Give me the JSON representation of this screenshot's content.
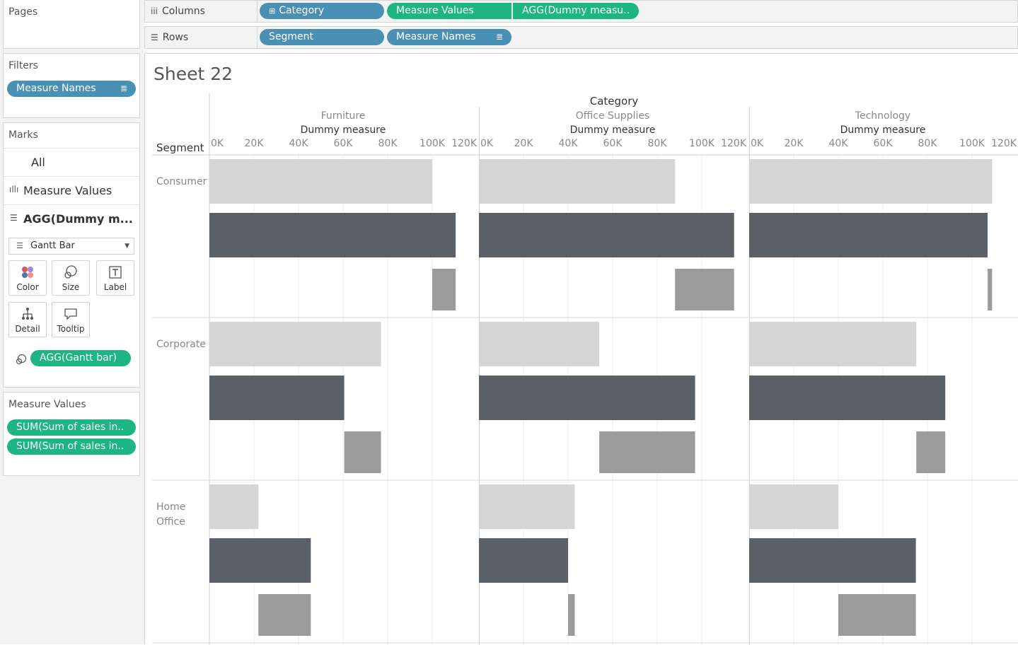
{
  "pages": {
    "title": "Pages"
  },
  "filters": {
    "title": "Filters",
    "pills": [
      {
        "label": "Measure Names"
      }
    ]
  },
  "marks": {
    "title": "Marks",
    "layers": [
      {
        "label": "All"
      },
      {
        "label": "Measure Values"
      },
      {
        "label": "AGG(Dummy m..."
      }
    ],
    "mark_type": "Gantt Bar",
    "buttons": [
      {
        "label": "Color"
      },
      {
        "label": "Size"
      },
      {
        "label": "Label"
      },
      {
        "label": "Detail"
      },
      {
        "label": "Tooltip"
      }
    ],
    "size_pill": "AGG(Gantt bar)"
  },
  "measure_values_card": {
    "title": "Measure Values",
    "pills": [
      {
        "label": "SUM(Sum of sales in.."
      },
      {
        "label": "SUM(Sum of sales in.."
      }
    ]
  },
  "columns_shelf": {
    "label": "Columns",
    "pills": [
      {
        "label": "Category",
        "prefix": "⊞"
      },
      {
        "label": "Measure Values"
      },
      {
        "label": "AGG(Dummy measu.."
      }
    ]
  },
  "rows_shelf": {
    "label": "Rows",
    "pills": [
      {
        "label": "Segment"
      },
      {
        "label": "Measure Names"
      }
    ]
  },
  "sheet": {
    "title": "Sheet 22"
  },
  "chart_data": {
    "type": "gantt",
    "header_title": "Category",
    "row_field": "Segment",
    "axis_title": "Dummy measure",
    "xlim": [
      0,
      120000
    ],
    "ticks": [
      "0K",
      "20K",
      "40K",
      "60K",
      "80K",
      "100K",
      "120K"
    ],
    "tick_values": [
      0,
      20000,
      40000,
      60000,
      80000,
      100000,
      120000
    ],
    "categories": [
      "Furniture",
      "Office Supplies",
      "Technology"
    ],
    "segments": [
      {
        "name": "Consumer",
        "display": [
          "Consumer"
        ]
      },
      {
        "name": "Corporate",
        "display": [
          "Corporate"
        ]
      },
      {
        "name": "Home Office",
        "display": [
          "Home",
          "Office"
        ]
      }
    ],
    "colors": {
      "light": "#d5d5d5",
      "dark": "#5b5f68",
      "mid": "#9b9b9b"
    },
    "bars": [
      {
        "segment": "Consumer",
        "category": "Furniture",
        "light": [
          0,
          100000
        ],
        "dark": [
          0,
          110500
        ],
        "mid": [
          100000,
          110500
        ]
      },
      {
        "segment": "Consumer",
        "category": "Office Supplies",
        "light": [
          0,
          88000
        ],
        "dark": [
          0,
          114500
        ],
        "mid": [
          88000,
          114500
        ]
      },
      {
        "segment": "Consumer",
        "category": "Technology",
        "light": [
          0,
          109000
        ],
        "dark": [
          0,
          107000
        ],
        "mid": [
          107000,
          109000
        ]
      },
      {
        "segment": "Corporate",
        "category": "Furniture",
        "light": [
          0,
          77000
        ],
        "dark": [
          0,
          60500
        ],
        "mid": [
          60500,
          77000
        ]
      },
      {
        "segment": "Corporate",
        "category": "Office Supplies",
        "light": [
          0,
          54000
        ],
        "dark": [
          0,
          97000
        ],
        "mid": [
          54000,
          97000
        ]
      },
      {
        "segment": "Corporate",
        "category": "Technology",
        "light": [
          0,
          75000
        ],
        "dark": [
          0,
          88000
        ],
        "mid": [
          75000,
          88000
        ]
      },
      {
        "segment": "Home Office",
        "category": "Furniture",
        "light": [
          0,
          22000
        ],
        "dark": [
          0,
          45500
        ],
        "mid": [
          22000,
          45500
        ]
      },
      {
        "segment": "Home Office",
        "category": "Office Supplies",
        "light": [
          0,
          43000
        ],
        "dark": [
          0,
          40000
        ],
        "mid": [
          40000,
          43000
        ]
      },
      {
        "segment": "Home Office",
        "category": "Technology",
        "light": [
          0,
          40000
        ],
        "dark": [
          0,
          74800
        ],
        "mid": [
          40000,
          74800
        ]
      }
    ]
  }
}
